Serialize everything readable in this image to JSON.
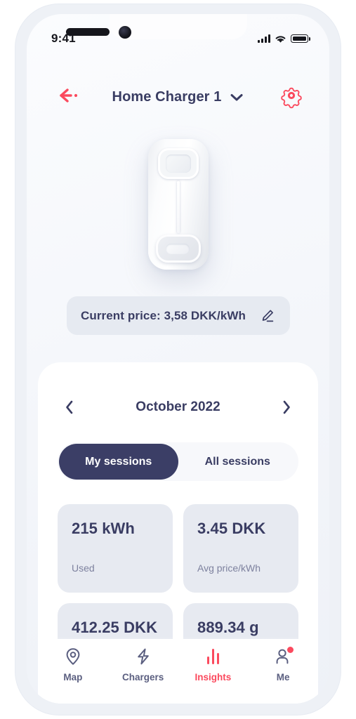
{
  "status_bar": {
    "time": "9:41",
    "signal_icon": "cellular-signal-icon",
    "wifi_icon": "wifi-icon",
    "battery_icon": "battery-full-icon"
  },
  "header": {
    "back_icon": "back-arrow-icon",
    "title": "Home Charger 1",
    "chevron_icon": "chevron-down-icon",
    "settings_icon": "gear-icon"
  },
  "charger": {
    "device_icon": "ev-charger-device-image"
  },
  "price_card": {
    "text": "Current price: 3,58 DKK/kWh",
    "edit_icon": "pencil-edit-icon"
  },
  "month_nav": {
    "prev_icon": "chevron-left-icon",
    "label": "October 2022",
    "next_icon": "chevron-right-icon"
  },
  "session_toggle": {
    "options": [
      {
        "label": "My sessions",
        "active": true
      },
      {
        "label": "All sessions",
        "active": false
      }
    ]
  },
  "stats": [
    {
      "value": "215 kWh",
      "label": "Used"
    },
    {
      "value": "3.45 DKK",
      "label": "Avg price/kWh"
    },
    {
      "value": "412.25 DKK",
      "label": ""
    },
    {
      "value": "889.34 g",
      "label": ""
    }
  ],
  "bottom_nav": {
    "items": [
      {
        "label": "Map",
        "icon": "map-pin-icon",
        "active": false,
        "badge": false
      },
      {
        "label": "Chargers",
        "icon": "bolt-icon",
        "active": false,
        "badge": false
      },
      {
        "label": "Insights",
        "icon": "bar-chart-icon",
        "active": true,
        "badge": false
      },
      {
        "label": "Me",
        "icon": "person-icon",
        "active": false,
        "badge": true
      }
    ]
  },
  "colors": {
    "accent_red": "#fb4a5e",
    "navy": "#3a3d63",
    "card_grey": "#e7eaf1",
    "muted_text": "#7d819e"
  }
}
